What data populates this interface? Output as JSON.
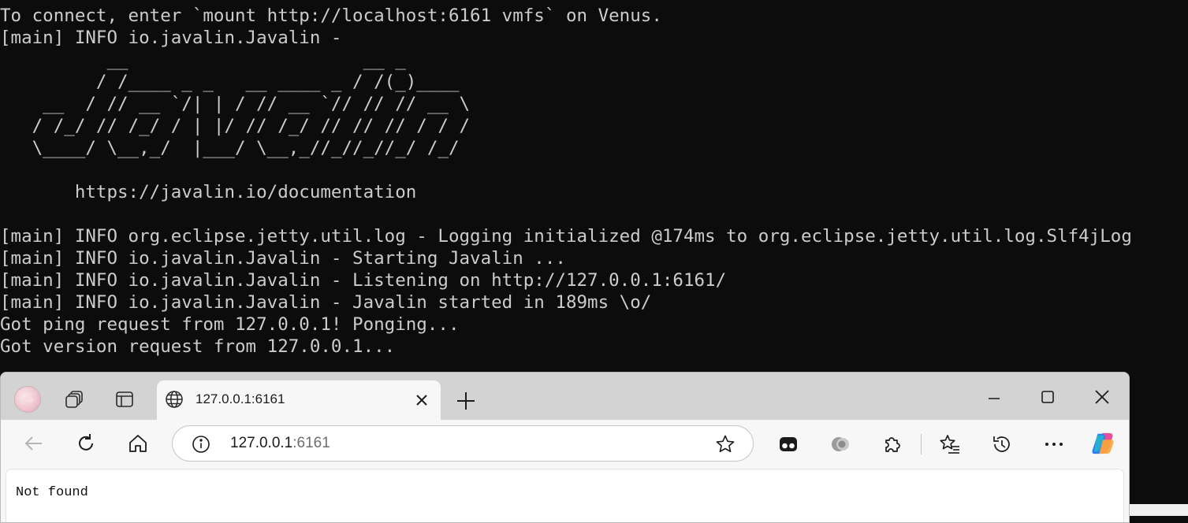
{
  "terminal": {
    "lines": [
      "To connect, enter `mount http://localhost:6161 vmfs` on Venus.",
      "[main] INFO io.javalin.Javalin -",
      "          __                      __ _",
      "         / /____ _ _   __ ____ _ / /(_)____",
      "    __  / // __ `/| | / // __ `// // // __ \\",
      "   / /_/ // /_/ / | |/ // /_/ // // // / / /",
      "   \\____/ \\__,_/  |___/ \\__,_//_//_//_/ /_/",
      "",
      "       https://javalin.io/documentation",
      "",
      "[main] INFO org.eclipse.jetty.util.log - Logging initialized @174ms to org.eclipse.jetty.util.log.Slf4jLog",
      "[main] INFO io.javalin.Javalin - Starting Javalin ...",
      "[main] INFO io.javalin.Javalin - Listening on http://127.0.0.1:6161/",
      "[main] INFO io.javalin.Javalin - Javalin started in 189ms \\o/",
      "Got ping request from 127.0.0.1! Ponging...",
      "Got version request from 127.0.0.1..."
    ]
  },
  "browser": {
    "tab": {
      "title": "127.0.0.1:6161"
    },
    "address": {
      "host": "127.0.0.1",
      "port": ":6161"
    },
    "page": {
      "text": "Not found"
    },
    "icons": {
      "profile": "profile-avatar",
      "workspaces": "workspaces-icon",
      "tab_actions": "tab-actions-icon",
      "site": "globe-icon",
      "close_tab": "close-icon",
      "new_tab": "plus-icon",
      "minimize": "minimize-icon",
      "maximize": "maximize-icon",
      "close_window": "close-icon",
      "back": "back-arrow-icon",
      "refresh": "refresh-icon",
      "home": "home-icon",
      "site_info": "info-icon",
      "favorite": "star-icon",
      "extension_1": "extension-icon",
      "extension_2": "extension-icon",
      "extensions": "puzzle-icon",
      "favorites": "favorites-icon",
      "history": "history-icon",
      "more": "more-icon",
      "copilot": "copilot-icon"
    },
    "colors": {
      "tabstrip": "#d3d3d3",
      "toolbar": "#f7f7f7",
      "terminal_bg": "#0c0c0c",
      "terminal_text": "#cccccc"
    }
  }
}
